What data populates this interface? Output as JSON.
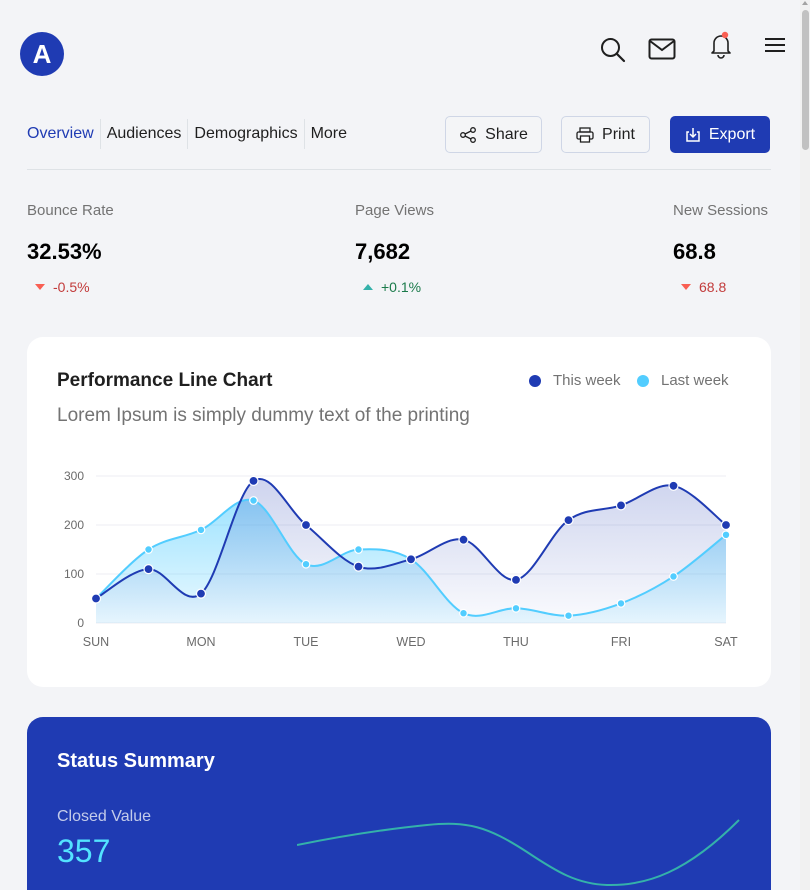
{
  "app": {
    "logo_letter": "A"
  },
  "header_icons": [
    "search-icon",
    "mail-icon",
    "bell-icon",
    "menu-icon"
  ],
  "tabs": [
    {
      "label": "Overview"
    },
    {
      "label": "Audiences"
    },
    {
      "label": "Demographics"
    },
    {
      "label": "More"
    }
  ],
  "actions": {
    "share_label": "Share",
    "print_label": "Print",
    "export_label": "Export"
  },
  "stats": [
    {
      "label": "Bounce Rate",
      "value": "32.53%",
      "delta": "-0.5%",
      "trend": "down"
    },
    {
      "label": "Page Views",
      "value": "7,682",
      "delta": "+0.1%",
      "trend": "up"
    },
    {
      "label": "New Sessions",
      "value": "68.8",
      "delta": "68.8",
      "trend": "down"
    }
  ],
  "performance": {
    "title": "Performance Line Chart",
    "subtitle": "Lorem Ipsum is simply dummy text of the printing",
    "legend": {
      "this_week": "This week",
      "last_week": "Last week"
    }
  },
  "chart_data": {
    "type": "line",
    "title": "Performance Line Chart",
    "x_tick_labels": [
      "SUN",
      "MON",
      "TUE",
      "WED",
      "THU",
      "FRI",
      "SAT"
    ],
    "x_points": [
      0,
      0.5,
      1,
      1.5,
      2,
      2.5,
      3,
      3.5,
      4,
      4.5,
      5,
      5.5,
      6
    ],
    "y_ticks": [
      0,
      100,
      200,
      300
    ],
    "ylim": [
      0,
      300
    ],
    "series": [
      {
        "name": "This week",
        "color": "#1f3bb3",
        "values": [
          50,
          110,
          60,
          290,
          200,
          115,
          130,
          170,
          88,
          210,
          240,
          280,
          200
        ]
      },
      {
        "name": "Last week",
        "color": "#52cdff",
        "values": [
          50,
          150,
          190,
          250,
          120,
          150,
          130,
          20,
          30,
          15,
          40,
          95,
          180
        ]
      }
    ],
    "grid": true,
    "legend_position": "top-right"
  },
  "status_summary": {
    "title": "Status Summary",
    "closed_label": "Closed Value",
    "closed_value": "357"
  },
  "colors": {
    "primary": "#1f3bb3",
    "accent": "#52cdff",
    "negative": "#f95f53",
    "positive": "#34b1aa"
  }
}
